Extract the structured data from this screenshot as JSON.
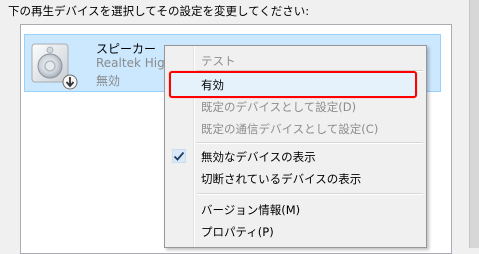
{
  "instruction": "下の再生デバイスを選択してその設定を変更してください:",
  "device": {
    "name": "スピーカー",
    "driver": "Realtek High",
    "status": "無効",
    "icon": "speaker-icon"
  },
  "context_menu": {
    "items": [
      {
        "label": "テスト",
        "enabled": false
      },
      {
        "label": "有効",
        "enabled": true,
        "highlighted": true
      },
      {
        "label": "既定のデバイスとして設定(D)",
        "enabled": false
      },
      {
        "label": "既定の通信デバイスとして設定(C)",
        "enabled": false
      },
      {
        "label": "無効なデバイスの表示",
        "enabled": true,
        "checked": true
      },
      {
        "label": "切断されているデバイスの表示",
        "enabled": true
      },
      {
        "label": "バージョン情報(M)",
        "enabled": true
      },
      {
        "label": "プロパティ(P)",
        "enabled": true
      }
    ]
  },
  "colors": {
    "selection": "#cce8ff",
    "highlight_border": "#ff0000",
    "disabled_text": "#8d8d8d"
  }
}
